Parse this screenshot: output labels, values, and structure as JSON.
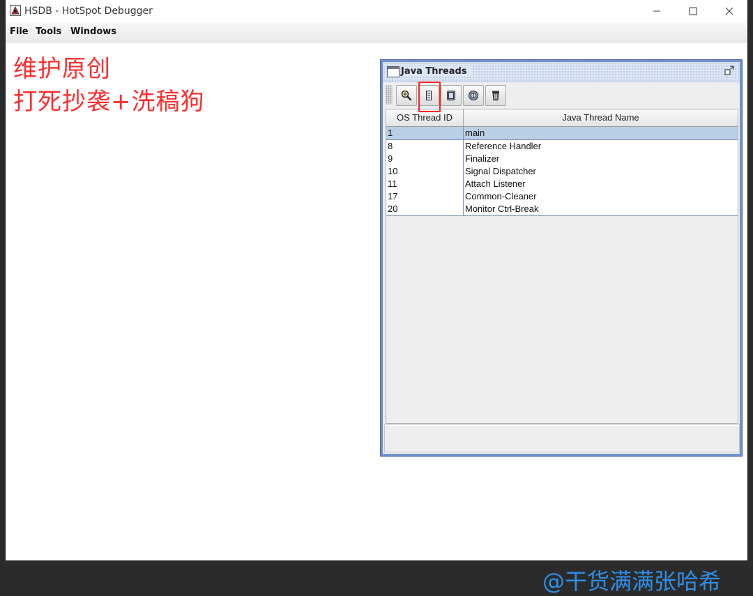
{
  "window": {
    "title": "HSDB - HotSpot Debugger",
    "controls": {
      "minimize": "minimize-icon",
      "maximize": "maximize-icon",
      "close": "close-icon"
    }
  },
  "menu": {
    "file": "File",
    "tools": "Tools",
    "windows": "Windows"
  },
  "overlay": {
    "line1": "维护原创",
    "line2": "打死抄袭+洗稿狗",
    "watermark": "@干货满满张哈希",
    "color": "#ff2d2d",
    "watermark_color": "#2f8ee8"
  },
  "java_threads": {
    "title": "Java Threads",
    "toolbar_icons": [
      "inspect-icon",
      "stack-memory-icon",
      "memory-icon",
      "info-icon",
      "delete-icon"
    ],
    "columns": [
      "OS Thread ID",
      "Java Thread Name"
    ],
    "rows": [
      {
        "id": "1",
        "name": "main",
        "selected": true
      },
      {
        "id": "8",
        "name": "Reference Handler",
        "selected": false
      },
      {
        "id": "9",
        "name": "Finalizer",
        "selected": false
      },
      {
        "id": "10",
        "name": "Signal Dispatcher",
        "selected": false
      },
      {
        "id": "11",
        "name": "Attach Listener",
        "selected": false
      },
      {
        "id": "17",
        "name": "Common-Cleaner",
        "selected": false
      },
      {
        "id": "20",
        "name": "Monitor Ctrl-Break",
        "selected": false
      }
    ],
    "selection_color": "#b8cfe5",
    "frame_border_color": "#6d8fcf"
  }
}
